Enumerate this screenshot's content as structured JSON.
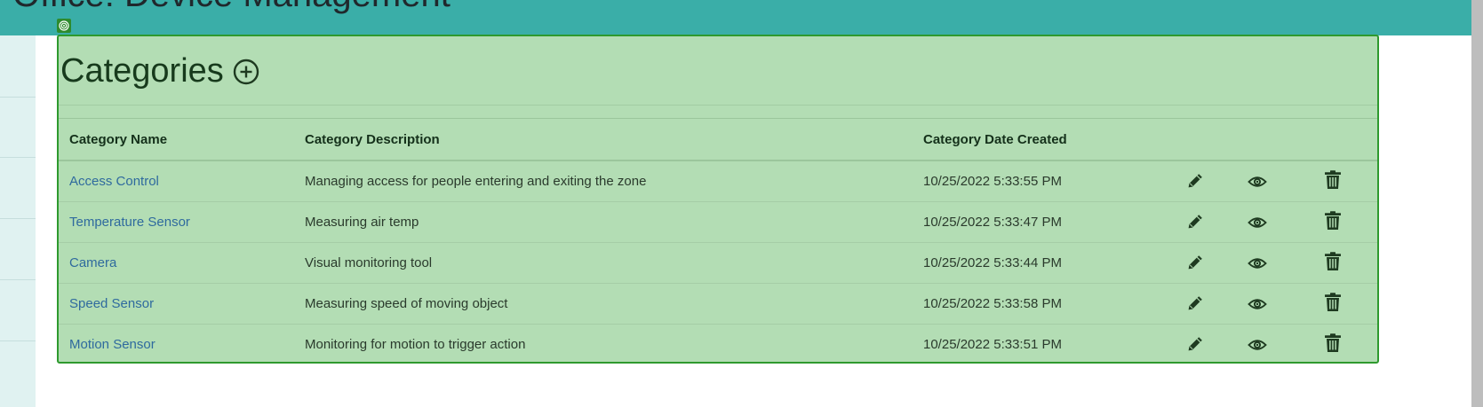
{
  "header": {
    "title": "Office: Device Management"
  },
  "categories_panel": {
    "title": "Categories",
    "add_icon": "plus-circle-icon",
    "table": {
      "columns": [
        "Category Name",
        "Category Description",
        "Category Date Created"
      ],
      "rows": [
        {
          "name": "Access Control",
          "description": "Managing access for people entering and exiting the zone",
          "date": "10/25/2022 5:33:55 PM"
        },
        {
          "name": "Temperature Sensor",
          "description": "Measuring air temp",
          "date": "10/25/2022 5:33:47 PM"
        },
        {
          "name": "Camera",
          "description": "Visual monitoring tool",
          "date": "10/25/2022 5:33:44 PM"
        },
        {
          "name": "Speed Sensor",
          "description": "Measuring speed of moving object",
          "date": "10/25/2022 5:33:58 PM"
        },
        {
          "name": "Motion Sensor",
          "description": "Monitoring for motion to trigger action",
          "date": "10/25/2022 5:33:51 PM"
        }
      ],
      "row_actions": [
        "pencil-icon",
        "eye-icon",
        "trash-icon"
      ]
    }
  },
  "colors": {
    "header_bg": "#3aaea8",
    "panel_bg": "#b3ddb4",
    "panel_border": "#2e9a2e",
    "link": "#2f6a9e",
    "icon": "#1e3a20"
  }
}
